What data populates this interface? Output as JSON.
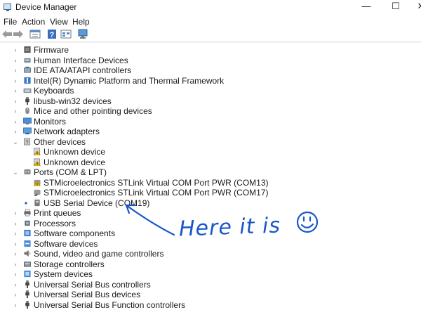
{
  "window": {
    "title": "Device Manager",
    "min_glyph": "—",
    "max_glyph": "☐",
    "close_glyph": "✕"
  },
  "menu": [
    "File",
    "Action",
    "View",
    "Help"
  ],
  "colors": {
    "accent": "#1a56c8",
    "annotation": "#1a56c8"
  },
  "tree": [
    {
      "label": "Firmware",
      "level": 0,
      "state": "collapsed",
      "icon": "firmware-icon"
    },
    {
      "label": "Human Interface Devices",
      "level": 0,
      "state": "collapsed",
      "icon": "hid-icon"
    },
    {
      "label": "IDE ATA/ATAPI controllers",
      "level": 0,
      "state": "collapsed",
      "icon": "ide-controller-icon"
    },
    {
      "label": "Intel(R) Dynamic Platform and Thermal Framework",
      "level": 0,
      "state": "collapsed",
      "icon": "thermal-framework-icon"
    },
    {
      "label": "Keyboards",
      "level": 0,
      "state": "collapsed",
      "icon": "keyboard-icon"
    },
    {
      "label": "libusb-win32 devices",
      "level": 0,
      "state": "collapsed",
      "icon": "usb-plug-icon"
    },
    {
      "label": "Mice and other pointing devices",
      "level": 0,
      "state": "collapsed",
      "icon": "mouse-icon"
    },
    {
      "label": "Monitors",
      "level": 0,
      "state": "collapsed",
      "icon": "monitor-icon"
    },
    {
      "label": "Network adapters",
      "level": 0,
      "state": "collapsed",
      "icon": "network-adapter-icon"
    },
    {
      "label": "Other devices",
      "level": 0,
      "state": "expanded",
      "icon": "other-devices-icon"
    },
    {
      "label": "Unknown device",
      "level": 1,
      "state": "leaf",
      "icon": "unknown-device-warning-icon"
    },
    {
      "label": "Unknown device",
      "level": 1,
      "state": "leaf",
      "icon": "unknown-device-warning-icon"
    },
    {
      "label": "Ports (COM & LPT)",
      "level": 0,
      "state": "expanded",
      "icon": "port-icon"
    },
    {
      "label": "STMicroelectronics STLink Virtual COM Port PWR (COM13)",
      "level": 1,
      "state": "leaf",
      "icon": "com-port-warning-icon"
    },
    {
      "label": "STMicroelectronics STLink Virtual COM Port PWR (COM17)",
      "level": 1,
      "state": "leaf",
      "icon": "com-port-icon"
    },
    {
      "label": "USB Serial Device (COM19)",
      "level": 1,
      "state": "leaf",
      "icon": "usb-serial-icon"
    },
    {
      "label": "Print queues",
      "level": 0,
      "state": "collapsed",
      "icon": "printer-icon"
    },
    {
      "label": "Processors",
      "level": 0,
      "state": "collapsed",
      "icon": "processor-icon"
    },
    {
      "label": "Software components",
      "level": 0,
      "state": "collapsed",
      "icon": "software-component-icon"
    },
    {
      "label": "Software devices",
      "level": 0,
      "state": "collapsed",
      "icon": "software-device-icon"
    },
    {
      "label": "Sound, video and game controllers",
      "level": 0,
      "state": "collapsed",
      "icon": "speaker-icon"
    },
    {
      "label": "Storage controllers",
      "level": 0,
      "state": "collapsed",
      "icon": "storage-controller-icon"
    },
    {
      "label": "System devices",
      "level": 0,
      "state": "collapsed",
      "icon": "system-device-icon"
    },
    {
      "label": "Universal Serial Bus controllers",
      "level": 0,
      "state": "collapsed",
      "icon": "usb-plug-icon"
    },
    {
      "label": "Universal Serial Bus devices",
      "level": 0,
      "state": "collapsed",
      "icon": "usb-plug-icon"
    },
    {
      "label": "Universal Serial Bus Function controllers",
      "level": 0,
      "state": "collapsed",
      "icon": "usb-plug-icon"
    }
  ],
  "annotation": {
    "text": "Here it is"
  }
}
